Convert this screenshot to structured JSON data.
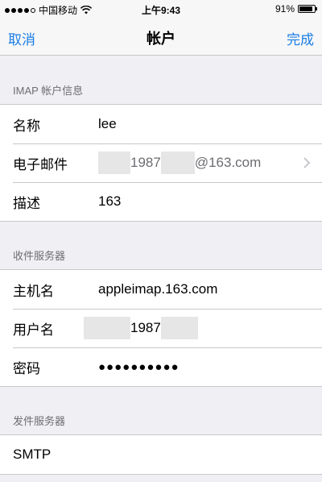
{
  "status_bar": {
    "carrier": "中国移动",
    "time": "上午9:43",
    "battery_percent": "91%",
    "battery_level": 0.91,
    "signal_bars_filled": 4,
    "signal_bars_total": 5
  },
  "nav": {
    "cancel_label": "取消",
    "title": "帐户",
    "done_label": "完成"
  },
  "imap_section": {
    "header": "IMAP 帐户信息",
    "rows": [
      {
        "label": "名称",
        "value": "lee"
      },
      {
        "label": "电子邮件",
        "value_middle": "1987",
        "value_suffix": "@163.com"
      },
      {
        "label": "描述",
        "value": "163"
      }
    ]
  },
  "incoming_section": {
    "header": "收件服务器",
    "rows": [
      {
        "label": "主机名",
        "value": "appleimap.163.com"
      },
      {
        "label": "用户名",
        "value_middle": "1987"
      },
      {
        "label": "密码",
        "value": "●●●●●●●●●●"
      }
    ]
  },
  "outgoing_section": {
    "header": "发件服务器",
    "rows": [
      {
        "label": "SMTP"
      }
    ]
  },
  "colors": {
    "accent": "#1a7ee6",
    "background": "#efeff4",
    "separator": "#c8c7cc",
    "secondary_text": "#6d6d72"
  },
  "icons": [
    "wifi-icon",
    "battery-icon",
    "signal-dots-icon",
    "chevron-right-icon"
  ]
}
